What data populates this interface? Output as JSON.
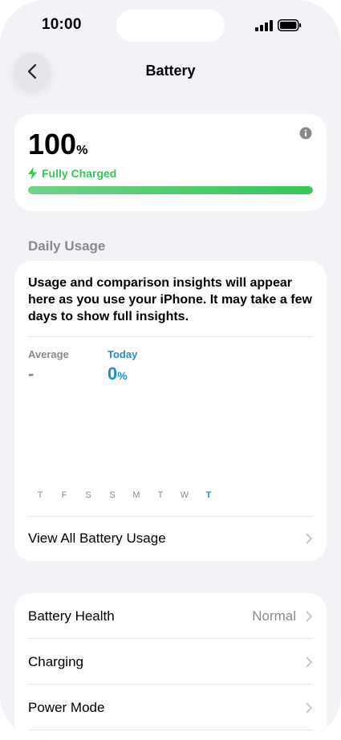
{
  "status_bar": {
    "time": "10:00",
    "signal_icon": "cellular-signal-icon",
    "battery_icon": "battery-full-icon"
  },
  "nav": {
    "title": "Battery",
    "back_icon": "chevron-left-icon"
  },
  "charge": {
    "percent": "100",
    "percent_unit": "%",
    "status": "Fully Charged",
    "level_fraction": 1.0,
    "info_icon": "info-icon",
    "accent_color": "#34c759"
  },
  "daily_usage": {
    "section_title": "Daily Usage",
    "message": "Usage and comparison insights will appear here as you use your iPhone. It may take a few days to show full insights.",
    "average_label": "Average",
    "average_value": "-",
    "today_label": "Today",
    "today_value": "0",
    "today_unit": "%",
    "days": [
      "T",
      "F",
      "S",
      "S",
      "M",
      "T",
      "W",
      "T"
    ],
    "today_index": 7,
    "view_all_label": "View All Battery Usage",
    "today_color": "#1a8fd6"
  },
  "settings": {
    "battery_health_label": "Battery Health",
    "battery_health_value": "Normal",
    "charging_label": "Charging",
    "power_mode_label": "Power Mode"
  }
}
